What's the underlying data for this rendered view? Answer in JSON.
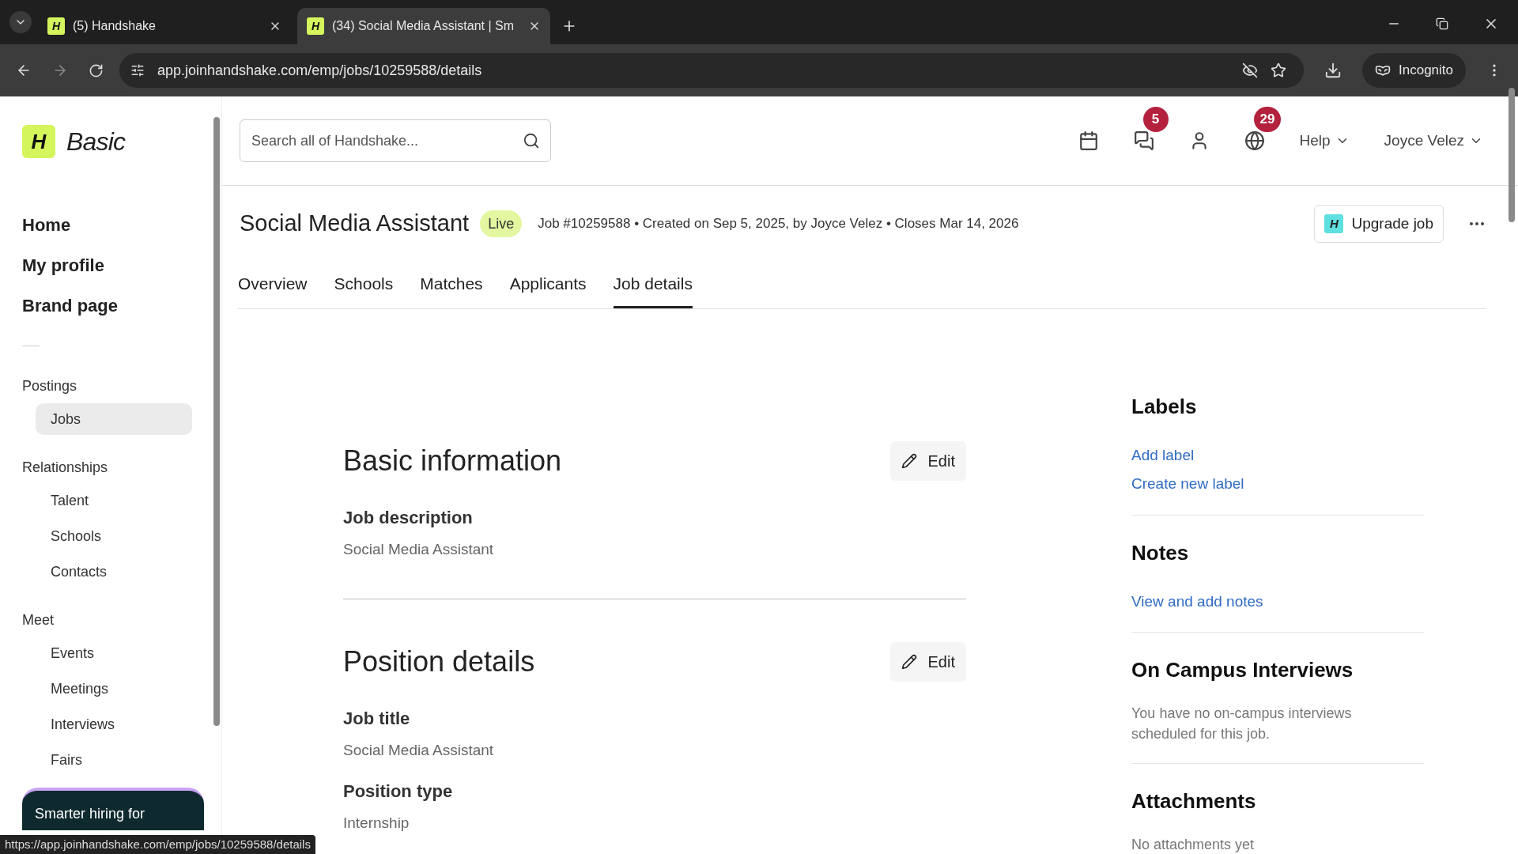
{
  "browser": {
    "tabs": [
      {
        "icon_letter": "H",
        "title": "(5) Handshake",
        "selected": false
      },
      {
        "icon_letter": "H",
        "title": "(34) Social Media Assistant | Sm",
        "selected": true
      }
    ],
    "url": "app.joinhandshake.com/emp/jobs/10259588/details",
    "incognito": "Incognito"
  },
  "sidebar": {
    "logo_letter": "H",
    "logo_text": "Basic",
    "primary_nav": [
      "Home",
      "My profile",
      "Brand page"
    ],
    "sections": [
      {
        "title": "Postings",
        "items": [
          {
            "label": "Jobs",
            "selected": true
          }
        ]
      },
      {
        "title": "Relationships",
        "items": [
          {
            "label": "Talent",
            "selected": false
          },
          {
            "label": "Schools",
            "selected": false
          },
          {
            "label": "Contacts",
            "selected": false
          }
        ]
      },
      {
        "title": "Meet",
        "items": [
          {
            "label": "Events",
            "selected": false
          },
          {
            "label": "Meetings",
            "selected": false
          },
          {
            "label": "Interviews",
            "selected": false
          },
          {
            "label": "Fairs",
            "selected": false
          }
        ]
      }
    ],
    "promo": "Smarter hiring for"
  },
  "header": {
    "search_placeholder": "Search all of Handshake...",
    "messages_badge": "5",
    "globe_badge": "29",
    "help": "Help",
    "user": "Joyce Velez"
  },
  "job": {
    "title": "Social Media Assistant",
    "status": "Live",
    "meta": "Job #10259588 • Created on Sep 5, 2025, by Joyce Velez • Closes Mar 14, 2026",
    "upgrade_letter": "H",
    "upgrade": "Upgrade job",
    "tabs": [
      {
        "label": "Overview",
        "selected": false
      },
      {
        "label": "Schools",
        "selected": false
      },
      {
        "label": "Matches",
        "selected": false
      },
      {
        "label": "Applicants",
        "selected": false
      },
      {
        "label": "Job details",
        "selected": true
      }
    ]
  },
  "sections": [
    {
      "title": "Basic information",
      "edit": "Edit",
      "fields": [
        {
          "label": "Job description",
          "value": "Social Media Assistant"
        }
      ]
    },
    {
      "title": "Position details",
      "edit": "Edit",
      "fields": [
        {
          "label": "Job title",
          "value": "Social Media Assistant"
        },
        {
          "label": "Position type",
          "value": "Internship"
        }
      ]
    }
  ],
  "side_panels": [
    {
      "title": "Labels",
      "links": [
        "Add label",
        "Create new label"
      ]
    },
    {
      "title": "Notes",
      "links": [
        "View and add notes"
      ]
    },
    {
      "title": "On Campus Interviews",
      "text": "You have no on-campus interviews scheduled for this job."
    },
    {
      "title": "Attachments",
      "text": "No attachments yet"
    }
  ],
  "status_url": "https://app.joinhandshake.com/emp/jobs/10259588/details"
}
